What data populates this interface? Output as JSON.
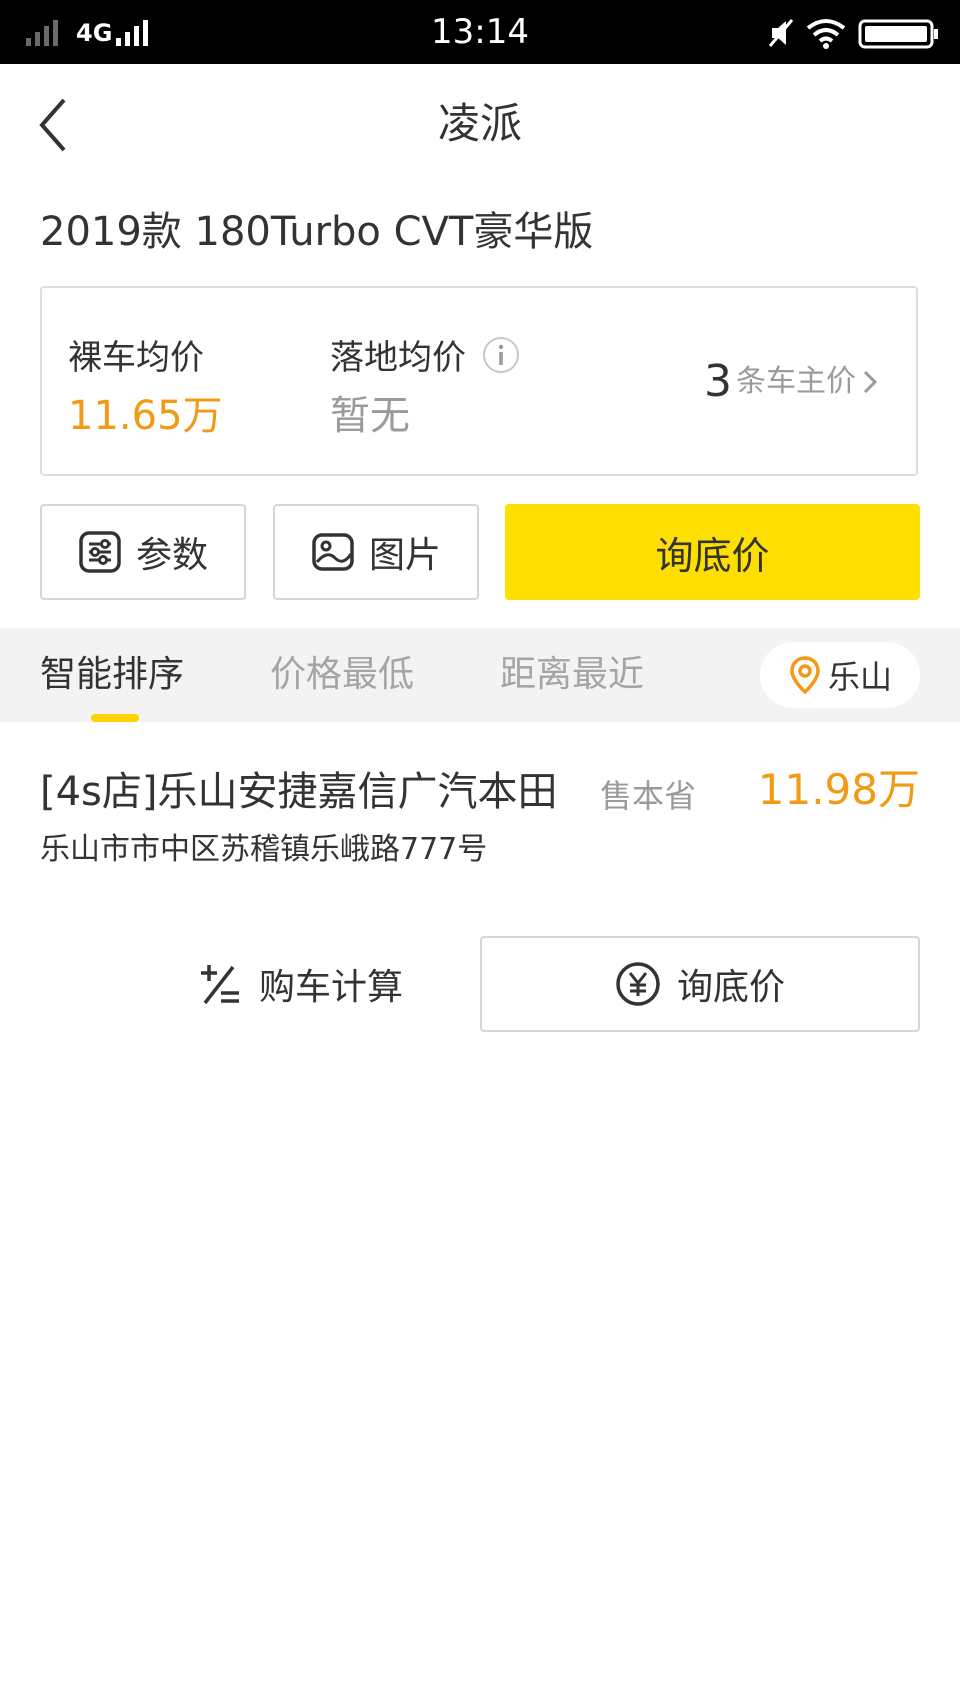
{
  "status_bar": {
    "network": "4G",
    "time": "13:14",
    "icons": [
      "signal-icon",
      "mute-icon",
      "wifi-icon",
      "battery-icon"
    ]
  },
  "nav": {
    "title": "凌派",
    "back_icon": "chevron-left-icon"
  },
  "model": {
    "name": "2019款 180Turbo CVT豪华版"
  },
  "price_card": {
    "bare_label": "裸车均价",
    "bare_value": "11.65万",
    "landed_label": "落地均价",
    "landed_value": "暂无",
    "owner_count": "3",
    "owner_text": "条车主价"
  },
  "actions": {
    "params_label": "参数",
    "photos_label": "图片",
    "inquiry_label": "询底价"
  },
  "sort": {
    "tabs": [
      "智能排序",
      "价格最低",
      "距离最近"
    ],
    "active_index": 0,
    "city": "乐山"
  },
  "dealer": {
    "name": "[4s店]乐山安捷嘉信广汽本田",
    "tag": "售本省",
    "price": "11.98万",
    "address": "乐山市市中区苏稽镇乐峨路777号",
    "calc_label": "购车计算",
    "inquiry_label": "询底价"
  },
  "colors": {
    "accent_yellow": "#ffdf00",
    "price_orange": "#f29a16",
    "status_bar_bg": "#000000",
    "sort_bar_bg": "#f2f3f2"
  }
}
